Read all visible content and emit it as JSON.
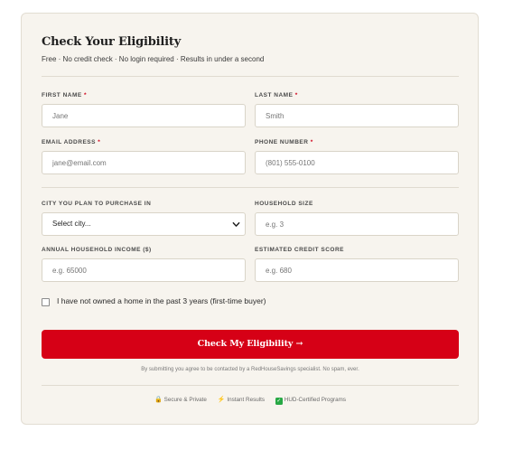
{
  "form": {
    "title": "Check Your Eligibility",
    "subtitle": "Free · No credit check · No login required · Results in under a second"
  },
  "fields": {
    "first_name": {
      "label": "FIRST NAME",
      "required": "*",
      "placeholder": "Jane"
    },
    "last_name": {
      "label": "LAST NAME",
      "required": "*",
      "placeholder": "Smith"
    },
    "email": {
      "label": "EMAIL ADDRESS",
      "required": "*",
      "placeholder": "jane@email.com"
    },
    "phone": {
      "label": "PHONE NUMBER",
      "required": "*",
      "placeholder": "(801) 555-0100"
    },
    "city": {
      "label": "CITY YOU PLAN TO PURCHASE IN",
      "selected": "Select city..."
    },
    "household_size": {
      "label": "HOUSEHOLD SIZE",
      "placeholder": "e.g. 3"
    },
    "income": {
      "label": "ANNUAL HOUSEHOLD INCOME ($)",
      "placeholder": "e.g. 65000"
    },
    "credit_score": {
      "label": "ESTIMATED CREDIT SCORE",
      "placeholder": "e.g. 680"
    }
  },
  "first_time_buyer": {
    "label": "I have not owned a home in the past 3 years (first-time buyer)",
    "checked": false
  },
  "submit": {
    "label": "Check My Eligibility →"
  },
  "disclaimer": "By submitting you agree to be contacted by a RedHouseSavings specialist. No spam, ever.",
  "trust_badges": [
    {
      "icon": "lock-icon",
      "glyph": "🔒",
      "label": "Secure & Private"
    },
    {
      "icon": "lightning-icon",
      "glyph": "⚡",
      "label": "Instant Results"
    },
    {
      "icon": "check-box-icon",
      "glyph": "✓",
      "label": "HUD-Certified Programs"
    }
  ],
  "colors": {
    "accent": "#d60016",
    "card_background": "#f7f4ee",
    "required_marker": "#d0021b",
    "badge_green": "#27a844"
  }
}
